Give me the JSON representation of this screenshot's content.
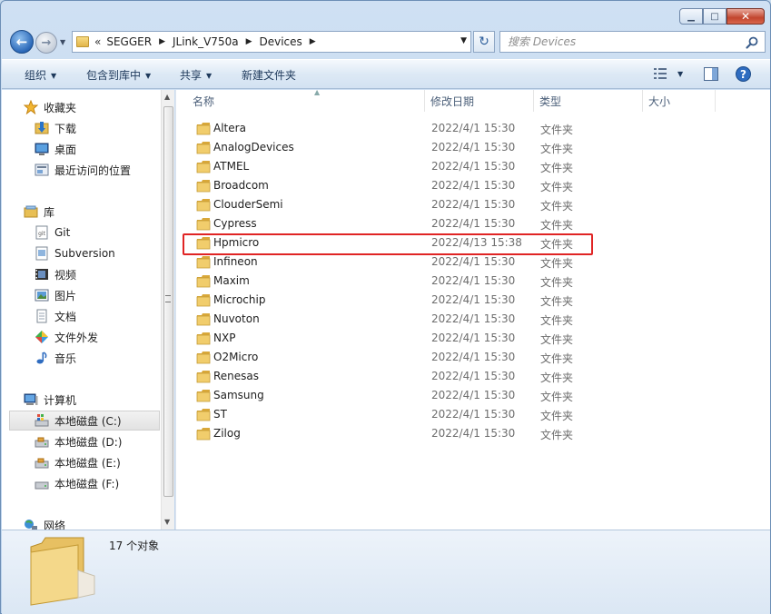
{
  "window": {
    "caption_min": "▁",
    "caption_max": "□",
    "caption_close": "✕"
  },
  "nav": {
    "back_glyph": "←",
    "forward_glyph": "→",
    "breadcrumb_prefix": "«",
    "breadcrumb": [
      "SEGGER",
      "JLink_V750a",
      "Devices"
    ],
    "refresh_glyph": "↻",
    "search_placeholder": "搜索 Devices"
  },
  "toolbar": {
    "organize": "组织",
    "include_library": "包含到库中",
    "share": "共享",
    "new_folder": "新建文件夹"
  },
  "sidebar": {
    "favorites": {
      "label": "收藏夹",
      "items": [
        {
          "label": "下载",
          "icon": "download-folder-icon"
        },
        {
          "label": "桌面",
          "icon": "desktop-icon"
        },
        {
          "label": "最近访问的位置",
          "icon": "recent-places-icon"
        }
      ]
    },
    "libraries": {
      "label": "库",
      "items": [
        {
          "label": "Git",
          "icon": "git-library-icon"
        },
        {
          "label": "Subversion",
          "icon": "subversion-library-icon"
        },
        {
          "label": "视频",
          "icon": "video-library-icon"
        },
        {
          "label": "图片",
          "icon": "pictures-library-icon"
        },
        {
          "label": "文档",
          "icon": "documents-library-icon"
        },
        {
          "label": "文件外发",
          "icon": "outgoing-files-icon"
        },
        {
          "label": "音乐",
          "icon": "music-library-icon"
        }
      ]
    },
    "computer": {
      "label": "计算机",
      "items": [
        {
          "label": "本地磁盘 (C:)",
          "icon": "system-drive-icon",
          "selected": true
        },
        {
          "label": "本地磁盘 (D:)",
          "icon": "local-drive-icon"
        },
        {
          "label": "本地磁盘 (E:)",
          "icon": "local-drive-icon"
        },
        {
          "label": "本地磁盘 (F:)",
          "icon": "local-drive-icon"
        }
      ]
    },
    "network": {
      "label": "网络"
    }
  },
  "columns": {
    "name": "名称",
    "date": "修改日期",
    "type": "类型",
    "size": "大小"
  },
  "files": [
    {
      "name": "Altera",
      "date": "2022/4/1 15:30",
      "type": "文件夹"
    },
    {
      "name": "AnalogDevices",
      "date": "2022/4/1 15:30",
      "type": "文件夹"
    },
    {
      "name": "ATMEL",
      "date": "2022/4/1 15:30",
      "type": "文件夹"
    },
    {
      "name": "Broadcom",
      "date": "2022/4/1 15:30",
      "type": "文件夹"
    },
    {
      "name": "ClouderSemi",
      "date": "2022/4/1 15:30",
      "type": "文件夹"
    },
    {
      "name": "Cypress",
      "date": "2022/4/1 15:30",
      "type": "文件夹"
    },
    {
      "name": "Hpmicro",
      "date": "2022/4/13 15:38",
      "type": "文件夹",
      "highlighted": true
    },
    {
      "name": "Infineon",
      "date": "2022/4/1 15:30",
      "type": "文件夹"
    },
    {
      "name": "Maxim",
      "date": "2022/4/1 15:30",
      "type": "文件夹"
    },
    {
      "name": "Microchip",
      "date": "2022/4/1 15:30",
      "type": "文件夹"
    },
    {
      "name": "Nuvoton",
      "date": "2022/4/1 15:30",
      "type": "文件夹"
    },
    {
      "name": "NXP",
      "date": "2022/4/1 15:30",
      "type": "文件夹"
    },
    {
      "name": "O2Micro",
      "date": "2022/4/1 15:30",
      "type": "文件夹"
    },
    {
      "name": "Renesas",
      "date": "2022/4/1 15:30",
      "type": "文件夹"
    },
    {
      "name": "Samsung",
      "date": "2022/4/1 15:30",
      "type": "文件夹"
    },
    {
      "name": "ST",
      "date": "2022/4/1 15:30",
      "type": "文件夹"
    },
    {
      "name": "Zilog",
      "date": "2022/4/1 15:30",
      "type": "文件夹"
    }
  ],
  "details": {
    "count": "17 个对象"
  },
  "colors": {
    "highlight": "#e02424",
    "folder": "#e8bf55",
    "chrome": "#c9dcef"
  }
}
